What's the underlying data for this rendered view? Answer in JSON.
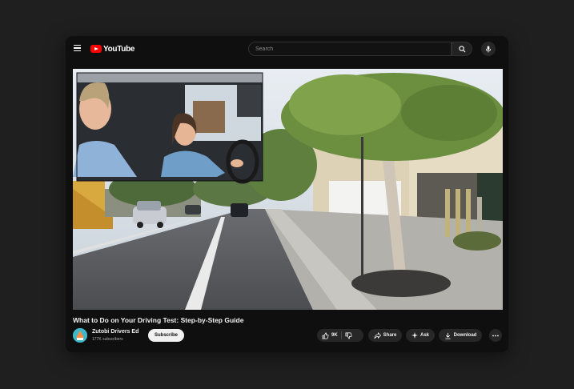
{
  "brand": {
    "logo_text": "YouTube",
    "logo_color": "#ff0000"
  },
  "search": {
    "placeholder": "Search",
    "value": ""
  },
  "video": {
    "title": "What to Do on Your Driving Test: Step-by-Step Guide",
    "thumbnail_description_icon": "street-scene-with-inset-driver"
  },
  "channel": {
    "name": "Zutobi Drivers Ed",
    "subscribers": "177K subscribers",
    "subscribe_label": "Subscribe",
    "avatar_color": "#3fb8c9"
  },
  "actions": {
    "likes": "9K",
    "share": "Share",
    "ask": "Ask",
    "download": "Download"
  },
  "icons": [
    "menu-icon",
    "youtube-logo",
    "search-icon",
    "mic-icon",
    "thumbs-up-icon",
    "thumbs-down-icon",
    "share-icon",
    "sparkle-icon",
    "download-icon",
    "more-icon"
  ]
}
